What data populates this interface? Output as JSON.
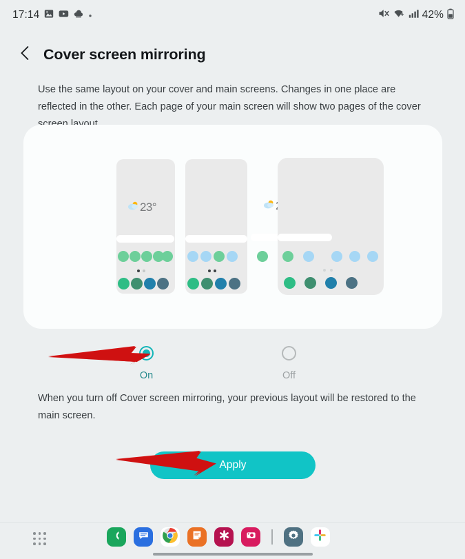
{
  "status_bar": {
    "clock": "17:14",
    "battery_percent": "42%",
    "left_icons": [
      "photos-icon",
      "youtube-icon",
      "cloud-upload-icon",
      "more-dot-icon"
    ],
    "right_icons": [
      "mute-icon",
      "wifi-icon",
      "signal-icon",
      "battery-icon"
    ]
  },
  "header": {
    "back_icon": "chevron-left-icon",
    "title": "Cover screen mirroring"
  },
  "description": "Use the same layout on your cover and main screens. Changes in one place are reflected in the other. Each page of your main screen will show two pages of the cover screen layout.",
  "preview": {
    "weather_temp": "23°",
    "weather_icon": "partly-cloudy-icon",
    "panels": [
      {
        "name": "cover-screen-page-1",
        "app_colors": [
          "#6dcf9a",
          "#6dcf9a",
          "#6dcf9a",
          "#6dcf9a",
          "#6dcf9a"
        ],
        "dock_colors": [
          "#2ebd85",
          "#3f8f70",
          "#2180ab",
          "#4c7284"
        ],
        "page_dots": [
          "#3b4043",
          "#c4c7c8"
        ]
      },
      {
        "name": "cover-screen-page-2",
        "app_colors": [
          "#a6d7f5",
          "#a6d7f5",
          "#6dcf9a",
          "#a6d7f5"
        ],
        "dock_colors": [
          "#2ebd85",
          "#3f8f70",
          "#2180ab",
          "#4c7284"
        ],
        "page_dots": [
          "#3b4043",
          "#3b4043"
        ]
      },
      {
        "name": "main-screen-page",
        "app_colors": [
          "#6dcf9a",
          "#a6d7f5",
          "#a6d7f5",
          "#a6d7f5",
          "#a6d7f5"
        ],
        "dock_colors": [
          "#2ebd85",
          "#3f8f70",
          "#2180ab",
          "#4c7284"
        ],
        "page_dots": [
          "#d3d6d7",
          "#d3d6d7"
        ]
      }
    ]
  },
  "toggle": {
    "on_label": "On",
    "off_label": "Off",
    "selected": "On",
    "accent_color": "#12b5b8"
  },
  "bottom_note": "When you turn off Cover screen mirroring, your previous layout will be restored to the main screen.",
  "apply_button": {
    "label": "Apply",
    "color": "#11c4c6"
  },
  "annotations": {
    "arrow_color": "#d61212",
    "arrows": [
      "arrow-to-on-radio",
      "arrow-to-apply-button"
    ]
  },
  "taskbar": {
    "apps_grid_icon": "apps-grid-icon",
    "items": [
      {
        "name": "phone-app",
        "icon": "phone-icon",
        "bg": "#1aa65c"
      },
      {
        "name": "messages-app",
        "icon": "message-bubble-icon",
        "bg": "#2a6fe0"
      },
      {
        "name": "chrome-app",
        "icon": "chrome-icon",
        "bg": "#ffffff"
      },
      {
        "name": "notes-app",
        "icon": "note-page-icon",
        "bg": "#ea7125"
      },
      {
        "name": "fitness-app",
        "icon": "asterisk-flower-icon",
        "bg": "#b5124f"
      },
      {
        "name": "camera-app",
        "icon": "camera-icon",
        "bg": "#d81b5f"
      },
      {
        "name": "dock-separator",
        "icon": "vertical-divider",
        "bg": ""
      },
      {
        "name": "settings-app",
        "icon": "gear-icon",
        "bg": "#4f7182"
      },
      {
        "name": "slack-app",
        "icon": "slack-icon",
        "bg": "#ffffff"
      }
    ]
  }
}
